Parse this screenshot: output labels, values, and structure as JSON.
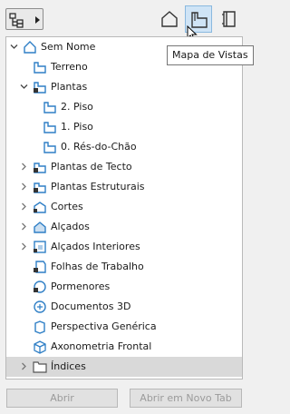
{
  "tooltip": "Mapa de Vistas",
  "tree": [
    {
      "label": "Sem Nome",
      "level": 0,
      "expanded": true,
      "icon": "project-root-icon"
    },
    {
      "label": "Terreno",
      "level": 1,
      "icon": "folder-blue-icon"
    },
    {
      "label": "Plantas",
      "level": 1,
      "expanded": true,
      "icon": "floorplan-folder-icon"
    },
    {
      "label": "2. Piso",
      "level": 2,
      "icon": "folder-blue-icon"
    },
    {
      "label": "1. Piso",
      "level": 2,
      "icon": "folder-blue-icon"
    },
    {
      "label": "0. Rés-do-Chão",
      "level": 2,
      "icon": "folder-blue-icon"
    },
    {
      "label": "Plantas de Tecto",
      "level": 1,
      "collapsed": true,
      "icon": "ceiling-plan-icon"
    },
    {
      "label": "Plantas Estruturais",
      "level": 1,
      "collapsed": true,
      "icon": "structural-plan-icon"
    },
    {
      "label": "Cortes",
      "level": 1,
      "collapsed": true,
      "icon": "section-icon"
    },
    {
      "label": "Alçados",
      "level": 1,
      "collapsed": true,
      "icon": "elevation-icon"
    },
    {
      "label": "Alçados Interiores",
      "level": 1,
      "collapsed": true,
      "icon": "interior-elevation-icon"
    },
    {
      "label": "Folhas de Trabalho",
      "level": 1,
      "icon": "worksheet-icon"
    },
    {
      "label": "Pormenores",
      "level": 1,
      "icon": "detail-icon"
    },
    {
      "label": "Documentos 3D",
      "level": 1,
      "icon": "3d-document-icon"
    },
    {
      "label": "Perspectiva Genérica",
      "level": 1,
      "icon": "perspective-icon"
    },
    {
      "label": "Axonometria Frontal",
      "level": 1,
      "icon": "axonometry-icon"
    },
    {
      "label": "Índices",
      "level": 1,
      "collapsed": true,
      "selected": true,
      "icon": "folder-icon"
    }
  ],
  "buttons": {
    "open": "Abrir",
    "open_new_tab": "Abrir em Novo Tab"
  },
  "colors": {
    "icon_blue": "#2f7fc6",
    "selection_grey": "#d9d9d9",
    "tab_active": "#cfe4f6"
  }
}
